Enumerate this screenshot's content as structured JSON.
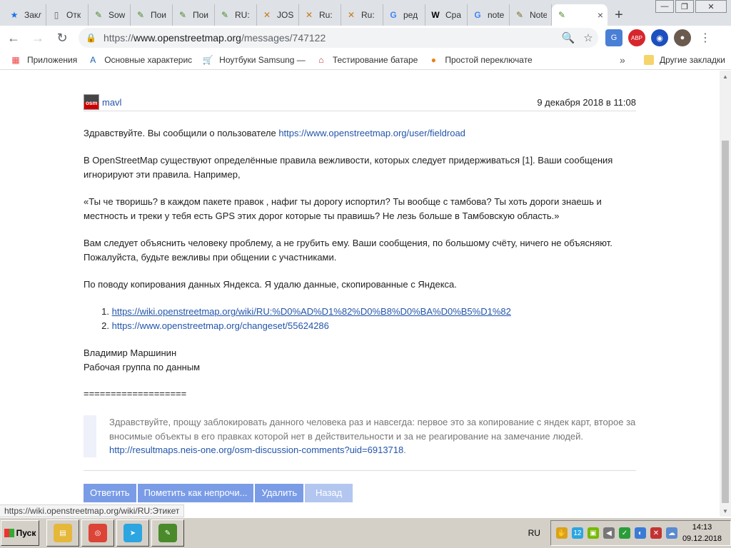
{
  "browser": {
    "tabs": [
      {
        "label": "Закл",
        "icon": "star-icon",
        "color": "#1a73e8",
        "glyph": "★"
      },
      {
        "label": "Отк",
        "icon": "page-icon",
        "color": "#5f6368",
        "glyph": "▯"
      },
      {
        "label": "Sow",
        "icon": "josm-icon",
        "color": "#4a8a2a",
        "glyph": "✎"
      },
      {
        "label": "Пои",
        "icon": "josm-icon",
        "color": "#4a8a2a",
        "glyph": "✎"
      },
      {
        "label": "Пои",
        "icon": "josm-icon",
        "color": "#4a8a2a",
        "glyph": "✎"
      },
      {
        "label": "RU:",
        "icon": "josm-icon",
        "color": "#4a8a2a",
        "glyph": "✎"
      },
      {
        "label": "JOS",
        "icon": "josm-map-icon",
        "color": "#c47a1a",
        "glyph": "✕"
      },
      {
        "label": "Ru:",
        "icon": "josm-map-icon",
        "color": "#c47a1a",
        "glyph": "✕"
      },
      {
        "label": "Ru:",
        "icon": "josm-map-icon",
        "color": "#c47a1a",
        "glyph": "✕"
      },
      {
        "label": "ред",
        "icon": "google-icon",
        "color": "#4285f4",
        "glyph": "G"
      },
      {
        "label": "Сра",
        "icon": "wikipedia-icon",
        "color": "#000000",
        "glyph": "W"
      },
      {
        "label": "note",
        "icon": "google-icon",
        "color": "#4285f4",
        "glyph": "G"
      },
      {
        "label": "Note",
        "icon": "notepad-icon",
        "color": "#7a6a2a",
        "glyph": "✎"
      }
    ],
    "active_tab": {
      "label": "",
      "icon": "osm-icon",
      "close": "×"
    },
    "new_tab": "+",
    "window": {
      "minimize": "—",
      "maximize": "❐",
      "close": "✕"
    },
    "nav": {
      "back": "←",
      "forward": "→",
      "reload": "↻"
    },
    "url": {
      "scheme": "https://",
      "host": "www.openstreetmap.org",
      "path": "/messages/747122"
    },
    "omnibox_icons": {
      "zoom": "🔍",
      "bookmark": "☆"
    },
    "extensions": [
      {
        "name": "translate-icon",
        "text": "G",
        "color": "#4a7fd6"
      },
      {
        "name": "adblock-icon",
        "text": "ABP",
        "color": "#d7262c"
      },
      {
        "name": "vpn-globe-icon",
        "text": "◉",
        "color": "#1c4fbf"
      },
      {
        "name": "profile-icon",
        "text": "●",
        "color": "#6b5b4f"
      },
      {
        "name": "menu-icon",
        "text": "⋮",
        "color": "#ffffff"
      }
    ],
    "bookmarks": [
      {
        "label": "Приложения",
        "icon": "apps-grid-icon",
        "glyph": "▦",
        "color": "#e44"
      },
      {
        "label": "Основные характерис",
        "icon": "bookmark-a-icon",
        "glyph": "A",
        "color": "#1a5fb4"
      },
      {
        "label": "Ноутбуки Samsung —",
        "icon": "cart-icon",
        "glyph": "🛒",
        "color": "#1a5fb4"
      },
      {
        "label": "Тестирование батаре",
        "icon": "home-icon",
        "glyph": "⌂",
        "color": "#b33"
      },
      {
        "label": "Простой переключате",
        "icon": "firefox-icon",
        "glyph": "●",
        "color": "#e8831a"
      }
    ],
    "bookmarks_more": "»",
    "other_bookmarks": "Другие закладки"
  },
  "message": {
    "sender": "mavl",
    "avatar_text": "osm",
    "date": "9 декабря 2018 в 11:08",
    "greeting_prefix": "Здравствуйте. Вы сообщили о пользователе ",
    "reported_user_link": "https://www.openstreetmap.org/user/fieldroad",
    "para1": "В OpenStreetMap существуют определённые правила вежливости, которых следует придерживаться [1]. Ваши сообщения игнорируют эти правила. Например,",
    "quote_text": "«Ты че творишь? в каждом пакете правок , нафиг ты дорогу испортил? Ты вообще с тамбова? Ты хоть дороги знаешь и местность и треки у тебя есть GPS этих дорог которые ты правишь? Не лезь больше в Тамбовскую область.»",
    "para2": "Вам следует объяснить человеку проблему, а не грубить ему. Ваши сообщения, по большому счёту, ничего не объясняют. Пожалуйста, будьте вежливы при общении с участниками.",
    "para3": "По поводу копирования данных Яндекса. Я удалю данные, скопированные с Яндекса.",
    "references": [
      {
        "num": "1.",
        "url": "https://wiki.openstreetmap.org/wiki/RU:%D0%AD%D1%82%D0%B8%D0%BA%D0%B5%D1%82"
      },
      {
        "num": "2.",
        "url": "https://www.openstreetmap.org/changeset/55624286"
      }
    ],
    "signature_name": "Владимир Маршинин",
    "signature_group": "Рабочая группа по данным",
    "separator": "===================",
    "reply_quote": "Здравствуйте, прощу заблокировать данного человека раз и навсегда: первое это за копирование с яндек карт, второе за вносимые объекты в его правках которой нет в действительности и за не реагирование на замечание людей.",
    "reply_quote_link": "http://resultmaps.neis-one.org/osm-discussion-comments?uid=6913718",
    "reply_quote_suffix": "."
  },
  "actions": {
    "reply": "Ответить",
    "mark_unread": "Пометить как непрочи...",
    "delete": "Удалить",
    "back": "Назад"
  },
  "status_link": "https://wiki.openstreetmap.org/wiki/RU:Этикет",
  "taskbar": {
    "start": "Пуск",
    "apps": [
      {
        "name": "explorer-taskbar-icon",
        "glyph": "▤",
        "color": "#e5b73b"
      },
      {
        "name": "chrome-taskbar-icon",
        "glyph": "◎",
        "color": "#db4437"
      },
      {
        "name": "telegram-taskbar-icon",
        "glyph": "➤",
        "color": "#2ca5e0",
        "badge": "12"
      },
      {
        "name": "josm-taskbar-icon",
        "glyph": "✎",
        "color": "#4a8a2a"
      }
    ],
    "lang": "RU",
    "tray": [
      {
        "name": "hand-tray-icon",
        "glyph": "✋",
        "color": "#d9a21a"
      },
      {
        "name": "telegram-tray-icon",
        "glyph": "12",
        "color": "#2ca5e0"
      },
      {
        "name": "nvidia-tray-icon",
        "glyph": "▣",
        "color": "#76b900"
      },
      {
        "name": "volume-tray-icon",
        "glyph": "◀",
        "color": "#777777"
      },
      {
        "name": "check-tray-icon",
        "glyph": "✓",
        "color": "#2a9d3a"
      },
      {
        "name": "network-tray-icon",
        "glyph": "◐",
        "color": "#3a7bd5"
      },
      {
        "name": "security-tray-icon",
        "glyph": "✕",
        "color": "#c33333"
      },
      {
        "name": "cloud-tray-icon",
        "glyph": "☁",
        "color": "#5a8ad0"
      }
    ],
    "time": "14:13",
    "date": "09.12.2018"
  }
}
